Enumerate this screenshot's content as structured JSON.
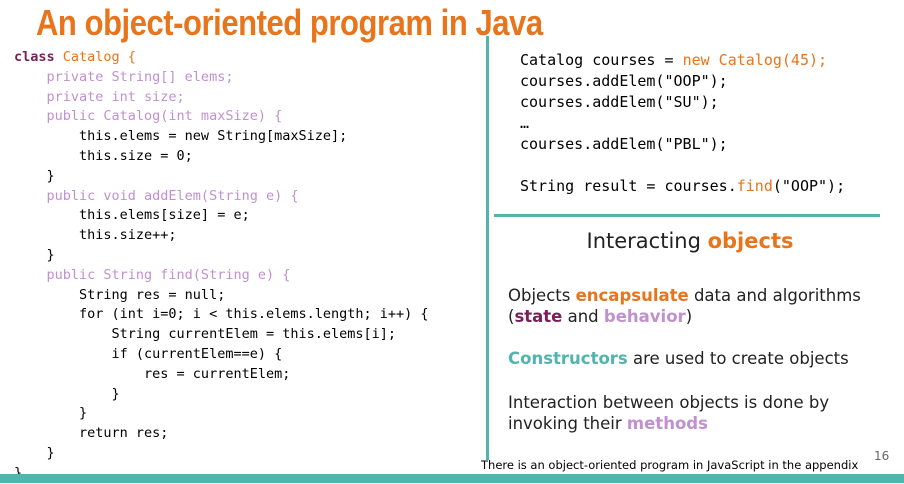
{
  "title": "An object-oriented program in Java",
  "code_left": {
    "l1_kw": "class",
    "l1_rest": " Catalog {",
    "l2": "    private String[] elems;",
    "l3": "    private int size;",
    "l4": "    public Catalog(int maxSize) {",
    "l5": "        this.elems = new String[maxSize];",
    "l6": "        this.size = 0;",
    "l7": "    }",
    "l8": "    public void addElem(String e) {",
    "l9": "        this.elems[size] = e;",
    "l10": "        this.size++;",
    "l11": "    }",
    "l12": "    public String find(String e) {",
    "l13": "        String res = null;",
    "l14": "        for (int i=0; i < this.elems.length; i++) {",
    "l15": "            String currentElem = this.elems[i];",
    "l16": "            if (currentElem==e) {",
    "l17": "                res = currentElem;",
    "l18": "            }",
    "l19": "        }",
    "l20": "        return res;",
    "l21": "    }",
    "l22": "}"
  },
  "code_right": {
    "l1_a": "Catalog courses = ",
    "l1_b": "new Catalog(45);",
    "l2": "courses.addElem(\"OOP\");",
    "l3": "courses.addElem(\"SU\");",
    "l4": "…",
    "l5": "courses.addElem(\"PBL\");",
    "l6_a": "String result = courses.",
    "l6_b": "find",
    "l6_c": "(\"OOP\");"
  },
  "section": {
    "title_a": "Interacting ",
    "title_b": "objects"
  },
  "paragraphs": {
    "p1_a": "Objects ",
    "p1_b": "encapsulate",
    "p1_c": " data and algorithms",
    "p1_d": "(",
    "p1_e": "state",
    "p1_f": " and ",
    "p1_g": "behavior",
    "p1_h": ")",
    "p2_a": "Constructors",
    "p2_b": " are used to create objects",
    "p3_a": "Interaction between objects is done by",
    "p3_b": "invoking their ",
    "p3_c": "methods"
  },
  "footnote": "There is an object-oriented program in JavaScript in the appendix",
  "page_number": "16",
  "colors": {
    "accent_orange": "#e8741c",
    "accent_teal": "#52b5ad",
    "keyword_maroon": "#7a1f5a",
    "method_lilac": "#c290d0"
  }
}
